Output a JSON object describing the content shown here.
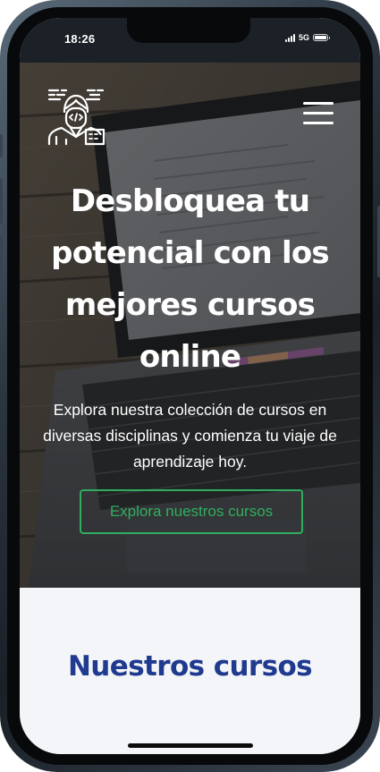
{
  "status_bar": {
    "time": "18:26",
    "network": "5G",
    "battery_level": 1.0
  },
  "header": {
    "logo_icon": "developer-avatar-logo-icon",
    "menu_icon": "hamburger-menu-icon"
  },
  "hero": {
    "title": "Desbloquea tu potencial con los mejores cursos online",
    "subtitle": "Explora nuestra colección de cursos en diversas disciplinas y comienza tu viaje de aprendizaje hoy.",
    "cta_label": "Explora nuestros cursos",
    "background": "laptop-on-wooden-desk-photo"
  },
  "courses": {
    "title": "Nuestros cursos"
  },
  "colors": {
    "accent_green": "#2fae60",
    "heading_blue": "#1f3a8f",
    "section_bg": "#f4f5f8",
    "status_bar_bg": "#1b2127"
  }
}
